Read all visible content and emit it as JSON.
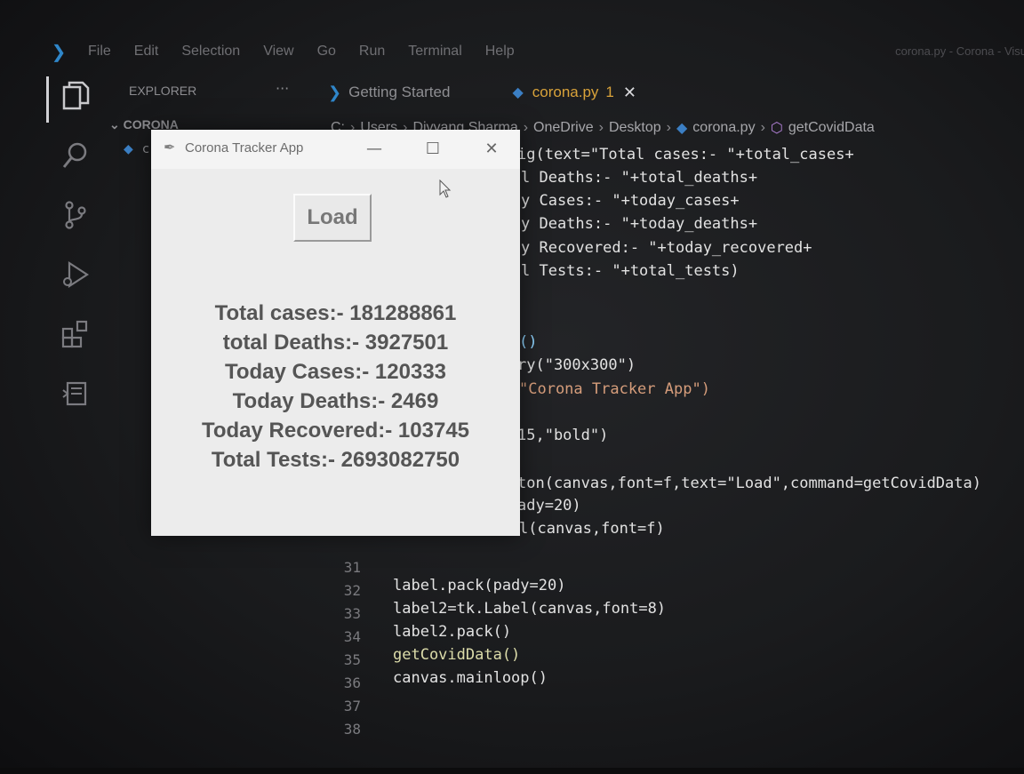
{
  "menubar": {
    "items": [
      "File",
      "Edit",
      "Selection",
      "View",
      "Go",
      "Run",
      "Terminal",
      "Help"
    ],
    "window_title": "corona.py - Corona - Visu"
  },
  "activitybar": {
    "icons": [
      "explorer-icon",
      "search-icon",
      "source-control-icon",
      "run-debug-icon",
      "extensions-icon",
      "remote-explorer-icon"
    ]
  },
  "sidebar": {
    "title": "EXPLORER",
    "more": "···",
    "folder": "CORONA",
    "file_partial": "c"
  },
  "tabs": [
    {
      "label": "Getting Started",
      "icon": "vscode-icon"
    },
    {
      "label": "corona.py",
      "badge": "1",
      "icon": "python-file-icon",
      "close": "✕"
    }
  ],
  "breadcrumb": {
    "parts": [
      "C:",
      "Users",
      "Divyang Sharma",
      "OneDrive",
      "Desktop"
    ],
    "file": "corona.py",
    "symbol": "getCovidData"
  },
  "code": {
    "visible_fragments": [
      "ig(text=\"Total cases:- \"+total_cases+",
      "l Deaths:- \"+total_deaths+",
      "y Cases:- \"+today_cases+",
      "y Deaths:- \"+today_deaths+",
      "y Recovered:- \"+today_recovered+",
      "l Tests:- \"+total_tests)",
      "()",
      "ry(\"300x300\")",
      "\"Corona Tracker App\")",
      "15,\"bold\")",
      "ton(canvas,font=f,text=\"Load\",command=getCovidData)",
      "ady=20)",
      "l(canvas,font=f)"
    ],
    "lines": [
      {
        "num": "31",
        "text": "label.pack(pady=20)"
      },
      {
        "num": "32",
        "text": "label2=tk.Label(canvas,font=8)"
      },
      {
        "num": "33",
        "text": "label2.pack()"
      },
      {
        "num": "34",
        "text": "getCovidData()"
      },
      {
        "num": "35",
        "text": "canvas.mainloop()"
      },
      {
        "num": "36",
        "text": ""
      },
      {
        "num": "37",
        "text": ""
      },
      {
        "num": "38",
        "text": ""
      }
    ]
  },
  "tk_window": {
    "title": "Corona Tracker App",
    "minimize": "—",
    "maximize": "☐",
    "close": "✕",
    "load_button": "Load",
    "stats": [
      "Total cases:- 181288861",
      "total Deaths:- 3927501",
      "Today Cases:- 120333",
      "Today Deaths:- 2469",
      "Today Recovered:- 103745",
      "Total Tests:- 2693082750"
    ]
  },
  "colors": {
    "accent_vscode": "#2f86c9",
    "modified_tab": "#d8a23a",
    "string": "#d69d7b",
    "keyword": "#8fd4ff"
  }
}
